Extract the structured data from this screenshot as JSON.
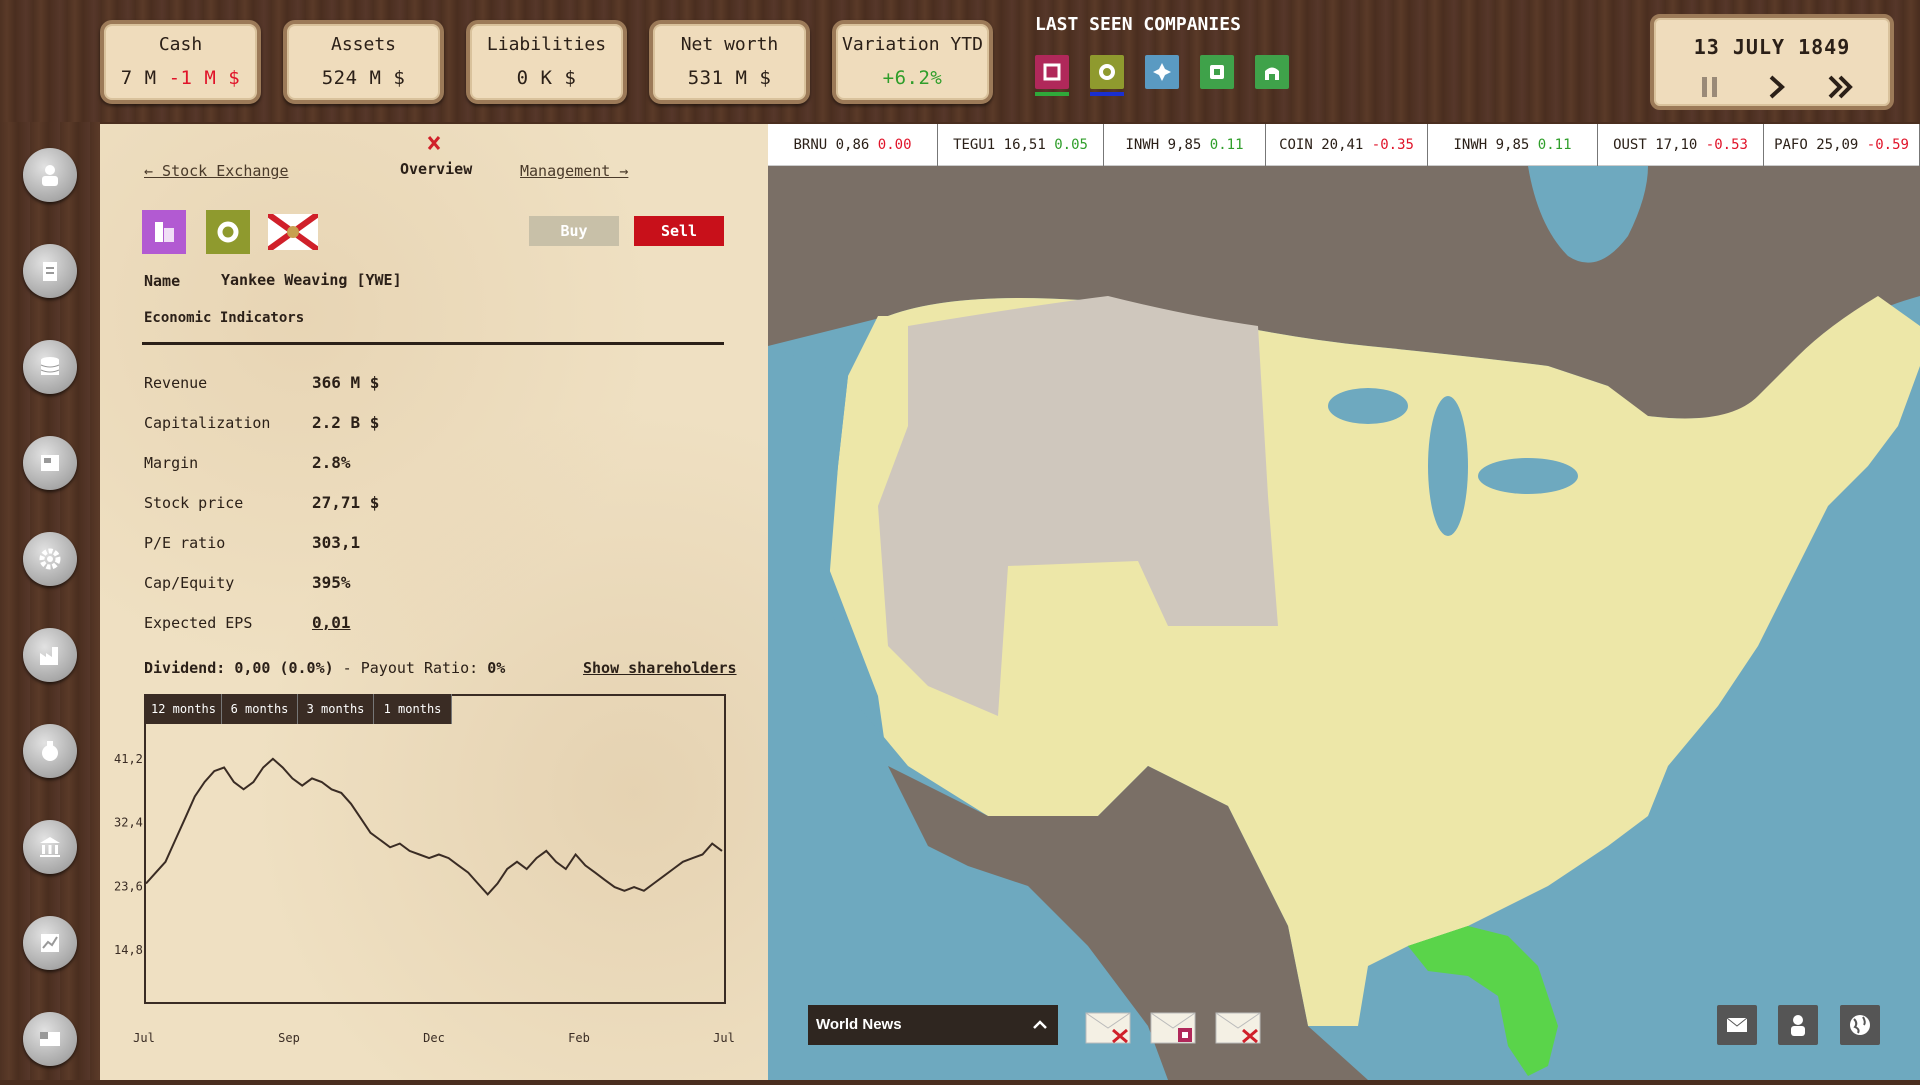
{
  "stats": [
    {
      "label": "Cash",
      "value": "7 M",
      "delta": "-1 M $"
    },
    {
      "label": "Assets",
      "value": "524 M $",
      "delta": ""
    },
    {
      "label": "Liabilities",
      "value": "0 K $",
      "delta": ""
    },
    {
      "label": "Net worth",
      "value": "531 M $",
      "delta": ""
    },
    {
      "label": "Variation YTD",
      "value": "",
      "delta": "+6.2%"
    }
  ],
  "last_seen": {
    "title": "LAST SEEN COMPANIES",
    "companies": [
      {
        "icon": "square-icon",
        "color": "#b0285a"
      },
      {
        "icon": "circle-icon",
        "color": "#8f9a2e"
      },
      {
        "icon": "cross-icon",
        "color": "#5a9ac2"
      },
      {
        "icon": "tag-icon",
        "color": "#3fa24a"
      },
      {
        "icon": "house-icon",
        "color": "#3fa24a"
      }
    ]
  },
  "date": "13 JULY 1849",
  "panel": {
    "nav_left": "← Stock Exchange",
    "nav_center": "Overview",
    "nav_right": "Management →",
    "buy": "Buy",
    "sell": "Sell",
    "name_label": "Name",
    "name_value": "Yankee Weaving [YWE]",
    "econ_title": "Economic Indicators",
    "indicators": [
      {
        "label": "Revenue",
        "value": "366 M $"
      },
      {
        "label": "Capitalization",
        "value": "2.2 B $"
      },
      {
        "label": "Margin",
        "value": "2.8%"
      },
      {
        "label": "Stock price",
        "value": "27,71 $"
      },
      {
        "label": "P/E ratio",
        "value": "303,1"
      },
      {
        "label": "Cap/Equity",
        "value": "395%"
      },
      {
        "label": "Expected EPS",
        "value": "0,01"
      }
    ],
    "dividend_label": "Dividend:",
    "dividend_value": "0,00 (0.0%)",
    "payout_label": " - Payout Ratio:",
    "payout_value": "0%",
    "show_shareholders": "Show shareholders",
    "tabs": [
      "12 months",
      "6 months",
      "3 months",
      "1 months"
    ]
  },
  "chart_data": {
    "type": "line",
    "title": "",
    "xlabel": "",
    "ylabel": "",
    "x_ticks": [
      "Jul",
      "Sep",
      "Dec",
      "Feb",
      "Jul"
    ],
    "y_ticks": [
      "41,2",
      "32,4",
      "23,6",
      "14,8"
    ],
    "ylim": [
      6,
      46
    ],
    "series": [
      {
        "values": [
          24,
          25.5,
          27,
          30,
          33,
          36,
          38,
          39.5,
          40,
          38,
          37,
          38,
          40,
          41.2,
          40,
          38.5,
          37.5,
          38.5,
          38,
          37,
          36.5,
          35,
          33,
          31,
          30,
          29,
          29.5,
          28.5,
          28,
          27.5,
          28,
          27.5,
          26.5,
          25.5,
          24,
          22.5,
          24,
          26,
          27,
          26,
          27.5,
          28.5,
          27,
          26,
          28,
          26.5,
          25.5,
          24.5,
          23.5,
          23,
          23.5,
          23,
          24,
          25,
          26,
          27,
          27.5,
          28,
          29.5,
          28.5
        ]
      }
    ],
    "grid": false
  },
  "ticker": [
    {
      "sym": "BRNU",
      "price": "0,86",
      "chg": "0.00",
      "dir": "down"
    },
    {
      "sym": "TEGU1",
      "price": "16,51",
      "chg": "0.05",
      "dir": "up"
    },
    {
      "sym": "INWH",
      "price": "9,85",
      "chg": "0.11",
      "dir": "up"
    },
    {
      "sym": "COIN",
      "price": "20,41",
      "chg": "-0.35",
      "dir": "down"
    },
    {
      "sym": "INWH",
      "price": "9,85",
      "chg": "0.11",
      "dir": "up"
    },
    {
      "sym": "OUST",
      "price": "17,10",
      "chg": "-0.53",
      "dir": "down"
    },
    {
      "sym": "PAFO",
      "price": "25,09",
      "chg": "-0.59",
      "dir": "down"
    }
  ],
  "news": {
    "title": "World News"
  }
}
